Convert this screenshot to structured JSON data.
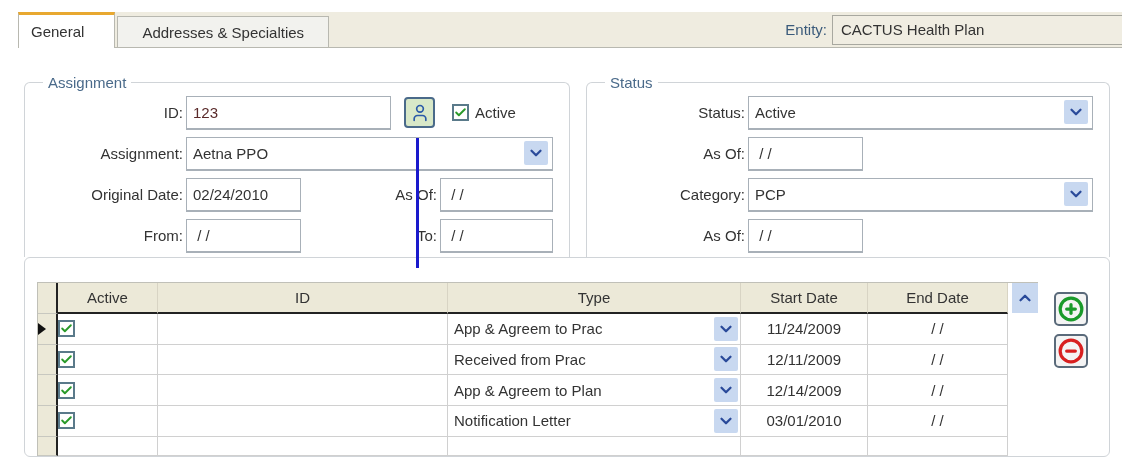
{
  "tabs": [
    {
      "label": "General",
      "selected": true
    },
    {
      "label": "Addresses & Specialties",
      "selected": false
    }
  ],
  "entity": {
    "label": "Entity:",
    "value": "CACTUS Health Plan"
  },
  "assignment": {
    "title": "Assignment",
    "id": {
      "label": "ID:",
      "value": "123"
    },
    "active": {
      "label": "Active",
      "checked": true
    },
    "assignment": {
      "label": "Assignment:",
      "value": "Aetna PPO"
    },
    "original_date": {
      "label": "Original Date:",
      "value": "02/24/2010"
    },
    "as_of": {
      "label": "As Of:",
      "value": " / /"
    },
    "from": {
      "label": "From:",
      "value": " / /"
    },
    "to": {
      "label": "To:",
      "value": " / /"
    }
  },
  "status": {
    "title": "Status",
    "fields": [
      {
        "kind": "combo",
        "label": "Status:",
        "value": "Active"
      },
      {
        "kind": "text",
        "label": "As Of:",
        "value": " / /"
      },
      {
        "kind": "combo",
        "label": "Category:",
        "value": "PCP"
      },
      {
        "kind": "text",
        "label": "As Of:",
        "value": " / /"
      }
    ]
  },
  "grid": {
    "columns": [
      "Active",
      "ID",
      "Type",
      "Start Date",
      "End Date"
    ],
    "rows": [
      {
        "selected": true,
        "active": true,
        "type": "App & Agreem to Prac",
        "start_date": "11/24/2009",
        "end_date": "/ /"
      },
      {
        "selected": false,
        "active": true,
        "type": "Received from Prac",
        "start_date": "12/11/2009",
        "end_date": "/ /"
      },
      {
        "selected": false,
        "active": true,
        "type": "App & Agreem to Plan",
        "start_date": "12/14/2009",
        "end_date": "/ /"
      },
      {
        "selected": false,
        "active": true,
        "type": "Notification Letter",
        "start_date": "03/01/2010",
        "end_date": "/ /"
      }
    ]
  }
}
